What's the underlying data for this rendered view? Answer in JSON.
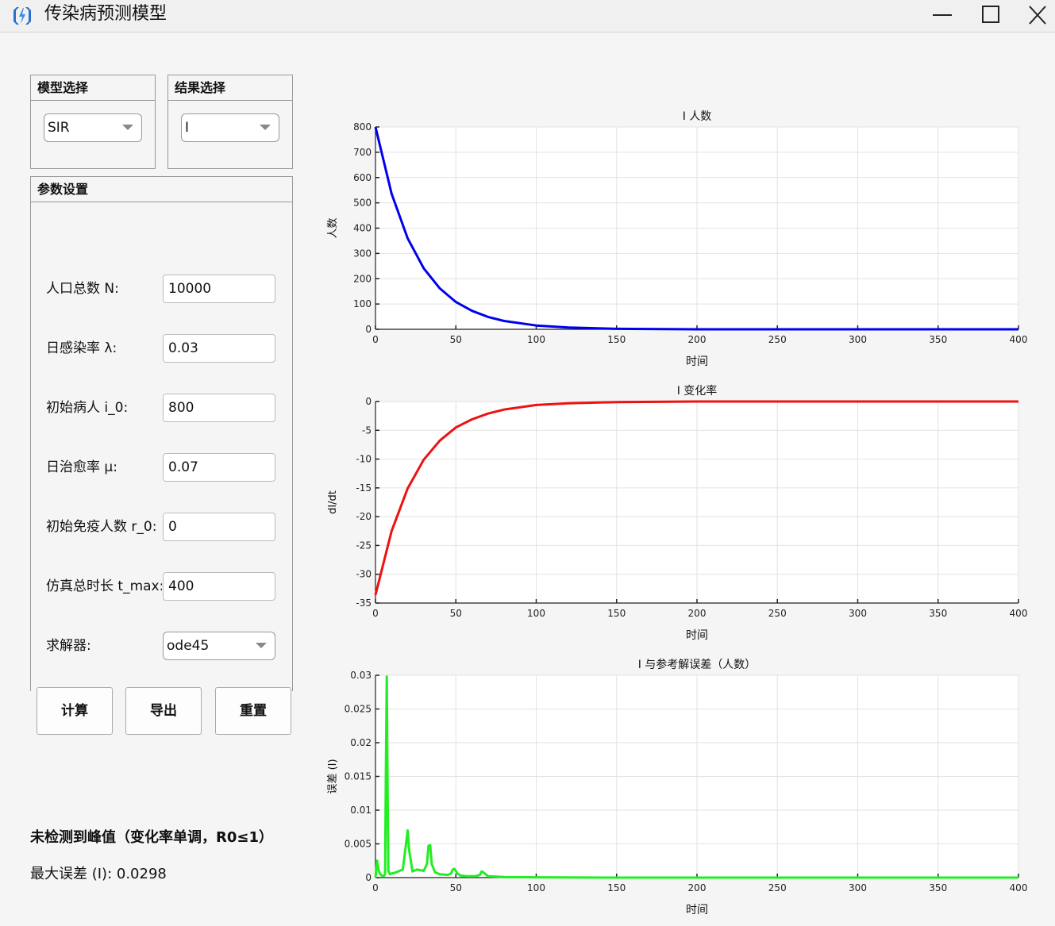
{
  "window": {
    "title": "传染病预测模型"
  },
  "model_panel": {
    "title": "模型选择",
    "selected": "SIR"
  },
  "result_panel": {
    "title": "结果选择",
    "selected": "I"
  },
  "params": {
    "title": "参数设置",
    "fields": [
      {
        "label": "人口总数 N:",
        "value": "10000"
      },
      {
        "label": "日感染率 λ:",
        "value": "0.03"
      },
      {
        "label": "初始病人 i_0:",
        "value": "800"
      },
      {
        "label": "日治愈率 μ:",
        "value": "0.07"
      },
      {
        "label": "初始免疫人数 r_0:",
        "value": "0"
      },
      {
        "label": "仿真总时长 t_max:",
        "value": "400"
      }
    ],
    "solver_label": "求解器:",
    "solver_value": "ode45"
  },
  "buttons": {
    "compute": "计算",
    "export": "导出",
    "reset": "重置"
  },
  "status": {
    "peak_message": "未检测到峰值（变化率单调，R0≤1）",
    "max_error": "最大误差 (I): 0.0298"
  },
  "chart_data": [
    {
      "type": "line",
      "title": "I 人数",
      "xlabel": "时间",
      "ylabel": "人数",
      "xlim": [
        0,
        400
      ],
      "ylim": [
        0,
        800
      ],
      "xticks": [
        0,
        50,
        100,
        150,
        200,
        250,
        300,
        350,
        400
      ],
      "yticks": [
        0,
        100,
        200,
        300,
        400,
        500,
        600,
        700,
        800
      ],
      "grid": true,
      "color": "#0000ee",
      "x": [
        0,
        10,
        20,
        30,
        40,
        50,
        60,
        70,
        80,
        100,
        120,
        150,
        200,
        250,
        300,
        350,
        400
      ],
      "y": [
        800,
        536,
        360,
        241,
        162,
        108,
        73,
        49,
        33,
        15,
        7,
        2,
        0,
        0,
        0,
        0,
        0
      ]
    },
    {
      "type": "line",
      "title": "I 变化率",
      "xlabel": "时间",
      "ylabel": "dI/dt",
      "xlim": [
        0,
        400
      ],
      "ylim": [
        -35,
        0
      ],
      "xticks": [
        0,
        50,
        100,
        150,
        200,
        250,
        300,
        350,
        400
      ],
      "yticks": [
        0,
        -5,
        -10,
        -15,
        -20,
        -25,
        -30,
        -35
      ],
      "grid": true,
      "color": "#ee1111",
      "x": [
        0,
        10,
        20,
        30,
        40,
        50,
        60,
        70,
        80,
        100,
        120,
        150,
        200,
        250,
        300,
        350,
        400
      ],
      "y": [
        -33.6,
        -22.5,
        -15.1,
        -10.1,
        -6.8,
        -4.5,
        -3.1,
        -2.1,
        -1.4,
        -0.6,
        -0.3,
        -0.1,
        0,
        0,
        0,
        0,
        0
      ]
    },
    {
      "type": "line",
      "title": "I 与参考解误差（人数）",
      "xlabel": "时间",
      "ylabel": "误差 (I)",
      "xlim": [
        0,
        400
      ],
      "ylim": [
        0,
        0.03
      ],
      "xticks": [
        0,
        50,
        100,
        150,
        200,
        250,
        300,
        350,
        400
      ],
      "yticks": [
        0,
        0.005,
        0.01,
        0.015,
        0.02,
        0.025,
        0.03
      ],
      "grid": true,
      "color": "#22ee22",
      "x": [
        0,
        1,
        2,
        3,
        4,
        5,
        6,
        6.5,
        7,
        7.5,
        8,
        9,
        10,
        12,
        15,
        17,
        19,
        20,
        21,
        23,
        26,
        30,
        32,
        33,
        34,
        35,
        37,
        40,
        45,
        47,
        48,
        49,
        50,
        51,
        53,
        57,
        62,
        65,
        66,
        67,
        70,
        80,
        100,
        150,
        200,
        300,
        400
      ],
      "y": [
        0,
        0.0025,
        0.001,
        0.0005,
        0.0003,
        0.0002,
        0.0005,
        0.017,
        0.0298,
        0.014,
        0.001,
        0.0005,
        0.0006,
        0.0007,
        0.001,
        0.0012,
        0.005,
        0.007,
        0.004,
        0.0009,
        0.0012,
        0.001,
        0.002,
        0.0047,
        0.0048,
        0.002,
        0.0008,
        0.0005,
        0.0004,
        0.0006,
        0.0012,
        0.0013,
        0.001,
        0.0006,
        0.0003,
        0.0002,
        0.0002,
        0.0004,
        0.0009,
        0.0008,
        0.0002,
        0.0001,
        5e-05,
        0,
        0,
        0,
        0
      ]
    }
  ]
}
